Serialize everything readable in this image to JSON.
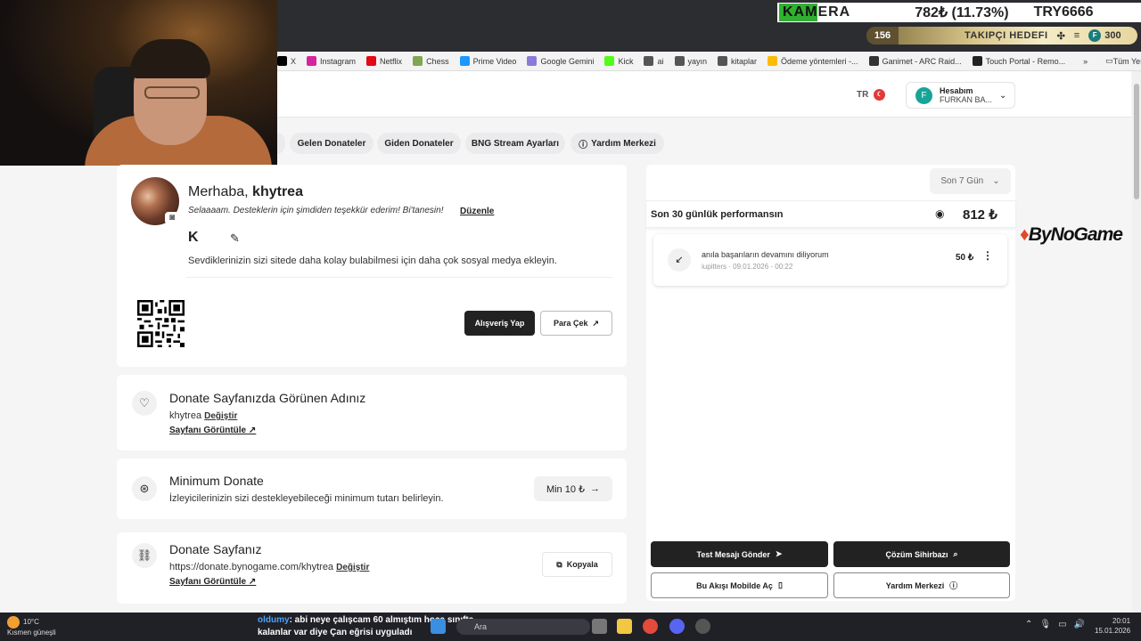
{
  "overlay": {
    "ticker": {
      "label_a": "KAM",
      "label_b": "ERA",
      "value": "782₺ (11.73%)",
      "currency": "TRY6666"
    },
    "goal": {
      "count": "156",
      "label": "TAKIPÇI HEDEFI",
      "avatar": "F",
      "max": "300"
    }
  },
  "bookmarks": [
    {
      "label": "X",
      "icon": "x-icon",
      "color": "#000000"
    },
    {
      "label": "Instagram",
      "icon": "instagram-icon",
      "color": "#d6249f"
    },
    {
      "label": "Netflix",
      "icon": "netflix-icon",
      "color": "#e50914"
    },
    {
      "label": "Chess",
      "icon": "chess-icon",
      "color": "#7fa650"
    },
    {
      "label": "Prime Video",
      "icon": "prime-video-icon",
      "color": "#1a98ff"
    },
    {
      "label": "Google Gemini",
      "icon": "gemini-icon",
      "color": "#8a7bd8"
    },
    {
      "label": "Kick",
      "icon": "kick-icon",
      "color": "#53fc18"
    },
    {
      "label": "ai",
      "icon": "folder-icon",
      "color": "#555555"
    },
    {
      "label": "yayın",
      "icon": "folder-icon",
      "color": "#555555"
    },
    {
      "label": "kitaplar",
      "icon": "folder-icon",
      "color": "#555555"
    },
    {
      "label": "Ödeme yöntemleri -...",
      "icon": "google-ads-icon",
      "color": "#fbbc04"
    },
    {
      "label": "Ganimet - ARC Raid...",
      "icon": "arc-raiders-icon",
      "color": "#333333"
    },
    {
      "label": "Touch Portal - Remo...",
      "icon": "touch-portal-icon",
      "color": "#222222"
    }
  ],
  "bookmarks_more": "»",
  "bookmarks_all": "Tüm Yer İşaretleri",
  "header": {
    "lang": "TR",
    "account_initial": "F",
    "account_title": "Hesabım",
    "account_name": "FURKAN BA..."
  },
  "tabs": [
    "Gelen Donateler",
    "Giden Donateler",
    "BNG Stream Ayarları",
    "Yardım Merkezi"
  ],
  "profile": {
    "greeting": "Merhaba,",
    "username": "khytrea",
    "bio": "Selaaaam. Desteklerin için şimdiden teşekkür ederim! Bi'tanesin!",
    "edit": "Düzenle",
    "social_hint": "Sevdiklerinizin sizi sitede daha kolay bulabilmesi için daha çok sosyal medya ekleyin.",
    "shop_button": "Alışveriş Yap",
    "withdraw_button": "Para Çek"
  },
  "display_name": {
    "title": "Donate Sayfanızda Görünen Adınız",
    "value": "khytrea",
    "change": "Değiştir",
    "view": "Sayfanı Görüntüle"
  },
  "min_donate": {
    "title": "Minimum Donate",
    "desc": "İzleyicilerinizin sizi destekleyebileceği minimum tutarı belirleyin.",
    "button": "Min 10 ₺"
  },
  "donate_page": {
    "title": "Donate Sayfanız",
    "url": "https://donate.bynogame.com/khytrea",
    "change": "Değiştir",
    "view": "Sayfanı Görüntüle",
    "copy": "Kopyala"
  },
  "performance": {
    "range": "Son 7 Gün",
    "label": "Son 30 günlük performansın",
    "amount": "812 ₺",
    "donation": {
      "message": "anıla başarıların devamını diliyorum",
      "user": "iupitters",
      "date": "09.01.2026 - 00:22",
      "amount": "50 ₺"
    }
  },
  "actions": {
    "test": "Test Mesajı Gönder",
    "wizard": "Çözüm Sihirbazı",
    "mobile": "Bu Akışı Mobilde Aç",
    "help": "Yardım Merkezi"
  },
  "brand": {
    "name": "ByNoGame"
  },
  "taskbar": {
    "temp": "10°C",
    "weather": "Kısmen güneşli",
    "chat_user": "oldumy",
    "chat_line1": ": abi neye çalışcam 60 almıştım hoca sınıfta",
    "chat_line2": "kalanlar var diye Çan eğrisi uyguladı",
    "search": "Ara",
    "time": "20:01",
    "date": "15.01.2026"
  },
  "colors": {
    "accent": "#222222",
    "teal": "#17a398",
    "kick_green": "#53fc18"
  }
}
